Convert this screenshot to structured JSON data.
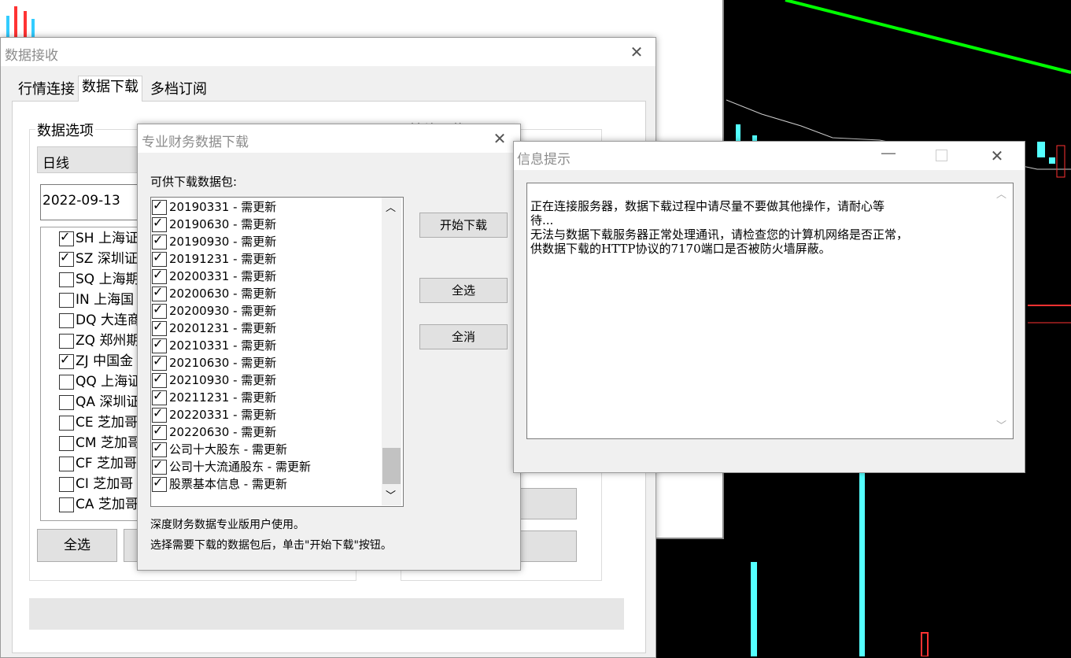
{
  "main_window": {
    "title": "数据接收",
    "tabs": [
      "行情连接",
      "数据下载",
      "多档订阅"
    ],
    "group_data_options": "数据选项",
    "group_other": "其他下载项",
    "period_select": "日线",
    "date_value": "2022-09-13",
    "markets": [
      {
        "label": "SH 上海证",
        "checked": true
      },
      {
        "label": "SZ 深圳证",
        "checked": true
      },
      {
        "label": "SQ 上海期",
        "checked": false
      },
      {
        "label": "IN 上海国",
        "checked": false
      },
      {
        "label": "DQ 大连商",
        "checked": false
      },
      {
        "label": "ZQ 郑州期",
        "checked": false
      },
      {
        "label": "ZJ 中国金",
        "checked": true
      },
      {
        "label": "QQ 上海证",
        "checked": false
      },
      {
        "label": "QA 深圳证",
        "checked": false
      },
      {
        "label": "CE 芝加哥",
        "checked": false
      },
      {
        "label": "CM 芝加哥",
        "checked": false
      },
      {
        "label": "CF 芝加哥",
        "checked": false
      },
      {
        "label": "CI 芝加哥",
        "checked": false
      },
      {
        "label": "CA 芝加哥",
        "checked": false
      }
    ],
    "select_all_label": "全选"
  },
  "finance_dialog": {
    "title": "专业财务数据下载",
    "list_label": "可供下载数据包:",
    "packages": [
      {
        "label": "20190331 - 需更新",
        "checked": true
      },
      {
        "label": "20190630 - 需更新",
        "checked": true
      },
      {
        "label": "20190930 - 需更新",
        "checked": true
      },
      {
        "label": "20191231 - 需更新",
        "checked": true
      },
      {
        "label": "20200331 - 需更新",
        "checked": true
      },
      {
        "label": "20200630 - 需更新",
        "checked": true
      },
      {
        "label": "20200930 - 需更新",
        "checked": true
      },
      {
        "label": "20201231 - 需更新",
        "checked": true
      },
      {
        "label": "20210331 - 需更新",
        "checked": true
      },
      {
        "label": "20210630 - 需更新",
        "checked": true
      },
      {
        "label": "20210930 - 需更新",
        "checked": true
      },
      {
        "label": "20211231 - 需更新",
        "checked": true
      },
      {
        "label": "20220331 - 需更新",
        "checked": true
      },
      {
        "label": "20220630 - 需更新",
        "checked": true
      },
      {
        "label": "公司十大股东 - 需更新",
        "checked": true
      },
      {
        "label": "公司十大流通股东 - 需更新",
        "checked": true
      },
      {
        "label": "股票基本信息 - 需更新",
        "checked": true
      }
    ],
    "start_download_label": "开始下载",
    "select_all_label": "全选",
    "deselect_all_label": "全消",
    "note1": "深度财务数据专业版用户使用。",
    "note2": "选择需要下载的数据包后，单击\"开始下载\"按钮。"
  },
  "info_dialog": {
    "title": "信息提示",
    "message_line1": "正在连接服务器，数据下载过程中请尽量不要做其他操作，请耐心等",
    "message_line2": "待...",
    "message_line3": "无法与数据下载服务器正常处理通讯，请检查您的计算机网络是否正常，",
    "message_line4": "供数据下载的HTTP协议的7170端口是否被防火墙屏蔽。"
  },
  "colors": {
    "chart_bg": "#000000",
    "cyan_bar": "#54ffff",
    "red_bar": "#ff3232",
    "green_line": "#00ff00"
  }
}
